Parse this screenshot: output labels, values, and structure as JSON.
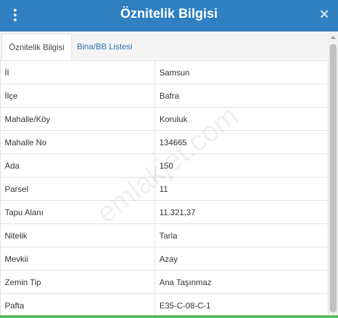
{
  "header": {
    "title": "Öznitelik Bilgisi",
    "menu_icon": "more-vertical-icon",
    "close_icon": "close-icon",
    "close_glyph": "✕",
    "color": "#2f7fc1"
  },
  "tabs": [
    {
      "label": "Öznitelik Bilgisi",
      "active": true
    },
    {
      "label": "Bina/BB Listesi",
      "active": false
    }
  ],
  "rows": [
    {
      "key": "İl",
      "value": "Samsun"
    },
    {
      "key": "İlçe",
      "value": "Bafra"
    },
    {
      "key": "Mahalle/Köy",
      "value": "Koruluk"
    },
    {
      "key": "Mahalle No",
      "value": "134665"
    },
    {
      "key": "Ada",
      "value": "150"
    },
    {
      "key": "Parsel",
      "value": "11"
    },
    {
      "key": "Tapu Alanı",
      "value": "11.321,37"
    },
    {
      "key": "Nitelik",
      "value": "Tarla"
    },
    {
      "key": "Mevkii",
      "value": "Azay"
    },
    {
      "key": "Zemin Tip",
      "value": "Ana Taşınmaz"
    },
    {
      "key": "Pafta",
      "value": "E35-C-08-C-1"
    }
  ],
  "watermark": "emlakjet.com",
  "bottom_bar_color": "#5cb85c"
}
